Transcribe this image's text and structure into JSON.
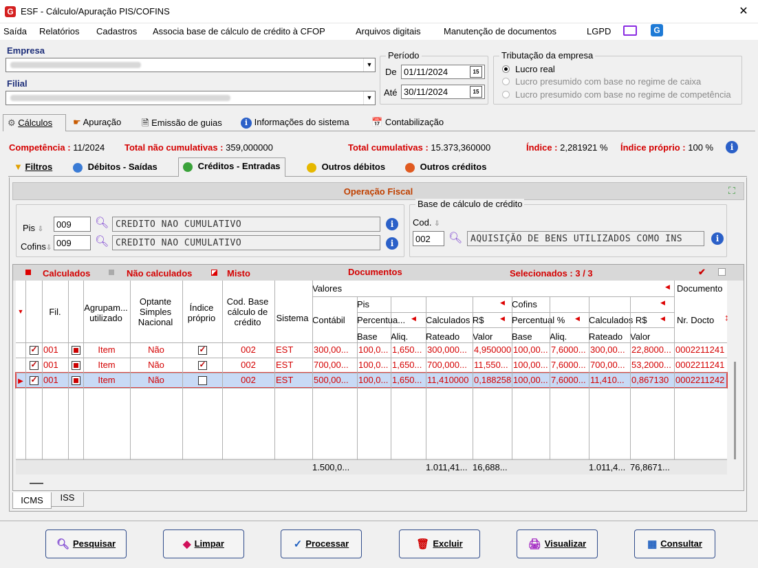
{
  "window": {
    "title": "ESF - Cálculo/Apuração PIS/COFINS",
    "close": "✕",
    "logo": "G"
  },
  "menu": [
    "Saída",
    "Relatórios",
    "Cadastros",
    "Associa base de cálculo de crédito à CFOP",
    "Arquivos digitais",
    "Manutenção de documentos",
    "LGPD"
  ],
  "empresa": {
    "label": "Empresa",
    "filial_label": "Filial"
  },
  "periodo": {
    "label": "Período",
    "de_label": "De",
    "de": "01/11/2024",
    "ate_label": "Até",
    "ate": "30/11/2024",
    "cal_icon": "15"
  },
  "tributacao": {
    "label": "Tributação da empresa",
    "options": [
      "Lucro real",
      "Lucro presumido com base no regime de caixa",
      "Lucro presumido com base no regime de competência"
    ],
    "selected": "Lucro real"
  },
  "main_tabs": [
    "Cálculos",
    "Apuração",
    "Emissão de guias",
    "Informações do sistema",
    "Contabilização"
  ],
  "summary": {
    "competencia_label": "Competência :",
    "competencia": "11/2024",
    "nao_cum_label": "Total não cumulativas :",
    "nao_cum": "359,000000",
    "cum_label": "Total cumulativas :",
    "cum": "15.373,360000",
    "indice_label": "Índice :",
    "indice": "2,281921 %",
    "indice_proprio_label": "Índice próprio :",
    "indice_proprio": "100 %"
  },
  "sub_tabs": [
    "Filtros",
    "Débitos - Saídas",
    "Créditos - Entradas",
    "Outros débitos",
    "Outros créditos"
  ],
  "operacao": {
    "title": "Operação Fiscal",
    "pis_label": "Pis",
    "pis_code": "009",
    "pis_desc": "CREDITO NAO CUMULATIVO",
    "cofins_label": "Cofins",
    "cofins_code": "009",
    "cofins_desc": "CREDITO NAO CUMULATIVO",
    "base_label": "Base de cálculo de crédito",
    "cod_label": "Cod.",
    "base_code": "002",
    "base_desc": "AQUISIÇÃO DE BENS UTILIZADOS COMO INS"
  },
  "legend": {
    "calculados": "Calculados",
    "nao_calculados": "Não calculados",
    "misto": "Misto",
    "documentos": "Documentos",
    "selecionados": "Selecionados : 3 / 3"
  },
  "grid": {
    "headers": {
      "fil": "Fil.",
      "agrup": "Agrupam... utilizado",
      "optante": "Optante Simples Nacional",
      "indice": "Índice próprio",
      "codbase": "Cod. Base cálculo de crédito",
      "sistema": "Sistema",
      "valores": "Valores",
      "documento": "Documento",
      "contabil": "Contábil",
      "pis": "Pis",
      "cofins": "Cofins",
      "percentual_pis": "Percentua...",
      "calc_pis": "Calculados R$",
      "percentual_cof": "Percentual %",
      "calc_cof": "Calculados R$",
      "base": "Base",
      "aliq": "Aliq.",
      "rateado": "Rateado",
      "valor": "Valor",
      "nrdocto": "Nr. Docto"
    },
    "rows": [
      {
        "fil": "001",
        "agrup": "Item",
        "optante": "Não",
        "indice": true,
        "cod": "002",
        "sistema": "EST",
        "contabil": "300,00...",
        "pis_base": "100,0...",
        "pis_aliq": "1,650...",
        "pis_rateado": "300,000...",
        "pis_valor": "4,950000",
        "cof_base": "100,00...",
        "cof_aliq": "7,6000...",
        "cof_rateado": "300,00...",
        "cof_valor": "22,8000...",
        "doc": "0002211241"
      },
      {
        "fil": "001",
        "agrup": "Item",
        "optante": "Não",
        "indice": true,
        "cod": "002",
        "sistema": "EST",
        "contabil": "700,00...",
        "pis_base": "100,0...",
        "pis_aliq": "1,650...",
        "pis_rateado": "700,000...",
        "pis_valor": "11,550...",
        "cof_base": "100,00...",
        "cof_aliq": "7,6000...",
        "cof_rateado": "700,00...",
        "cof_valor": "53,2000...",
        "doc": "0002211241"
      },
      {
        "fil": "001",
        "agrup": "Item",
        "optante": "Não",
        "indice": false,
        "cod": "002",
        "sistema": "EST",
        "contabil": "500,00...",
        "pis_base": "100,0...",
        "pis_aliq": "1,650...",
        "pis_rateado": "11,410000",
        "pis_valor": "0,188258",
        "cof_base": "100,00...",
        "cof_aliq": "7,6000...",
        "cof_rateado": "11,410...",
        "cof_valor": "0,867130",
        "doc": "0002211242"
      }
    ],
    "totals": {
      "contabil": "1.500,0...",
      "pis_rateado": "1.011,41...",
      "pis_valor": "16,688...",
      "cof_rateado": "1.011,4...",
      "cof_valor": "76,8671..."
    }
  },
  "bottom_tabs": [
    "ICMS",
    "ISS"
  ],
  "buttons": [
    "Pesquisar",
    "Limpar",
    "Processar",
    "Excluir",
    "Visualizar",
    "Consultar"
  ],
  "colors": {
    "red": "#d40000",
    "selected_row": "#c8daf5",
    "header_bar": "#d8d8d8"
  }
}
